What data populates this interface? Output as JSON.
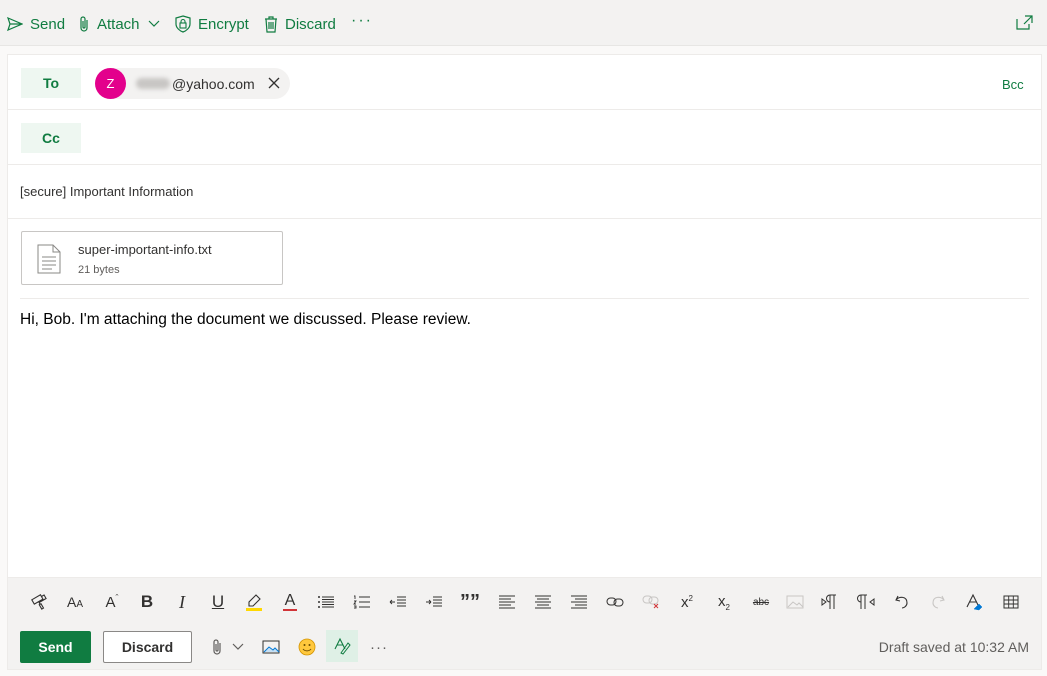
{
  "toolbar": {
    "send_label": "Send",
    "attach_label": "Attach",
    "encrypt_label": "Encrypt",
    "discard_label": "Discard",
    "more_label": "···"
  },
  "recipients": {
    "to_label": "To",
    "cc_label": "Cc",
    "bcc_label": "Bcc",
    "to": [
      {
        "initial": "Z",
        "address_visible": "@yahoo.com",
        "avatar_color": "#e3008c"
      }
    ]
  },
  "subject": "[secure] Important Information",
  "attachment": {
    "name": "super-important-info.txt",
    "size": "21 bytes"
  },
  "body": "Hi, Bob. I'm attaching the document we discussed. Please review.",
  "format_toolbar": {
    "superscript_glyph": "x",
    "superscript_sup": "2",
    "subscript_glyph": "x",
    "subscript_sub": "2",
    "strikethrough_text": "abc",
    "quote_glyph": "””",
    "font_size_glyph": "A",
    "font_size_small": "A",
    "grow_glyph": "A",
    "grow_mark": "ˆ",
    "bold_glyph": "B",
    "italic_glyph": "I",
    "underline_glyph": "U",
    "font_color_glyph": "A"
  },
  "actions": {
    "send_label": "Send",
    "discard_label": "Discard",
    "more_label": "···",
    "draft_status": "Draft saved at 10:32 AM"
  },
  "colors": {
    "accent": "#107c41",
    "avatar": "#e3008c",
    "highlight": "#ffd800",
    "font_color": "#d13438"
  }
}
